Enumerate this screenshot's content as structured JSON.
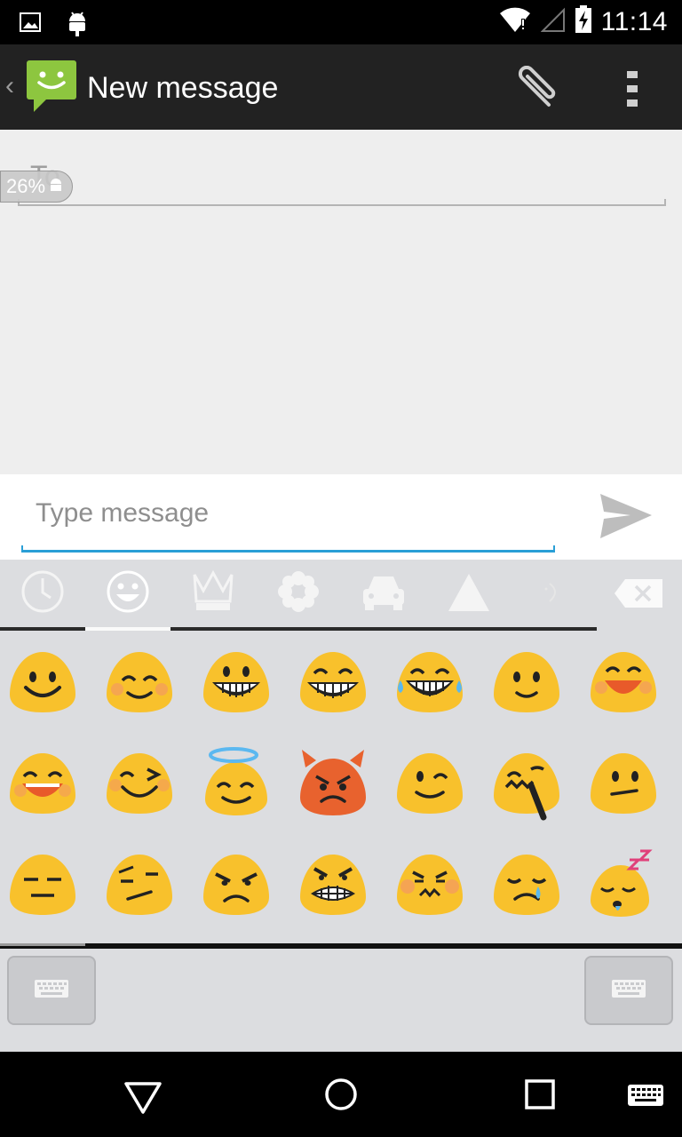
{
  "status_bar": {
    "time": "11:14",
    "icons": [
      "image-notification-icon",
      "android-notification-icon",
      "wifi-icon",
      "signal-icon",
      "battery-icon"
    ]
  },
  "action_bar": {
    "title": "New message",
    "icons": [
      "back-caret-icon",
      "messaging-app-icon",
      "attach-icon",
      "overflow-menu-icon"
    ]
  },
  "recipient": {
    "label": "To",
    "progress_text": "26%"
  },
  "compose": {
    "placeholder": "Type message",
    "accent_color": "#2a9fd6"
  },
  "keyboard": {
    "tabs": [
      {
        "name": "recent",
        "icon": "clock-icon",
        "active": false
      },
      {
        "name": "people",
        "icon": "smiley-icon",
        "active": true
      },
      {
        "name": "objects",
        "icon": "crown-icon",
        "active": false
      },
      {
        "name": "nature",
        "icon": "flower-icon",
        "active": false
      },
      {
        "name": "places",
        "icon": "car-icon",
        "active": false
      },
      {
        "name": "symbols",
        "icon": "triangle-icon",
        "active": false
      },
      {
        "name": "emoticons",
        "icon": "emoticon-icon",
        "active": false
      }
    ],
    "emoji_rows": [
      [
        "smiling-face",
        "smiling-eyes-face",
        "grinning-face",
        "grinning-smiling-eyes-face",
        "tears-of-joy-face",
        "slightly-smiling-face",
        "laughing-face"
      ],
      [
        "squinting-laughing-face",
        "winking-squint-face",
        "angel-face",
        "angry-devil-face",
        "winking-face",
        "confounded-face",
        "neutral-smirk-face"
      ],
      [
        "expressionless-face",
        "skeptical-face",
        "angry-face",
        "grimacing-angry-face",
        "pouting-face",
        "sad-tear-face",
        "sleeping-face"
      ]
    ],
    "switch_keys": [
      "keyboard-icon",
      "keyboard-icon"
    ]
  },
  "nav_bar": {
    "buttons": [
      "back-icon",
      "home-icon",
      "recents-icon",
      "keyboard-icon"
    ]
  },
  "colors": {
    "emoji_yellow": "#f8c12c",
    "emoji_devil": "#e8622e",
    "action_bar": "#222222",
    "app_icon_green": "#8dc63f"
  }
}
